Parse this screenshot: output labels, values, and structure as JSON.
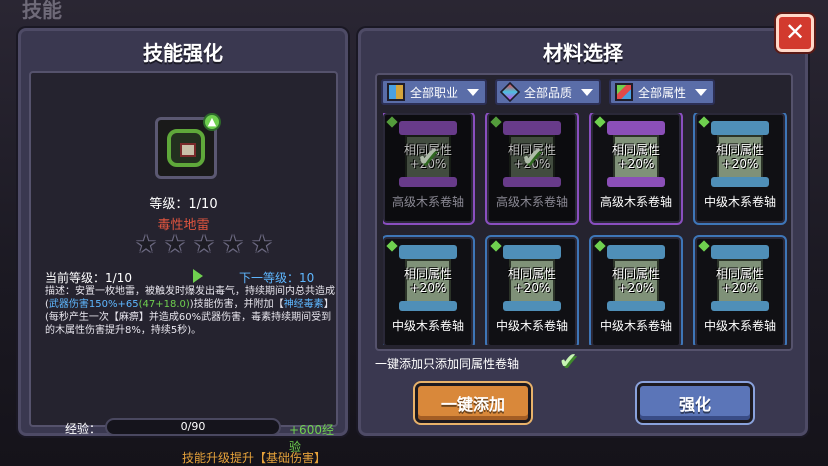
{
  "background": {
    "title": "技能"
  },
  "left_panel": {
    "title": "技能强化",
    "level_text": "等级：1/10",
    "skill_name": "毒性地雷",
    "stars": [
      0,
      0,
      0,
      0,
      0
    ],
    "current_level": "当前等级：1/10",
    "next_level": "下一等级：10",
    "description_1": "描述：安置一枚地雷，被触发时爆发出毒气，持续期间内总共造成(",
    "description_hl": "武器伤害150%+65",
    "description_hl2": "(47+18.0)",
    "description_2": ")技能伤害，并附加【",
    "description_hl3": "神经毒素",
    "description_3": "】(每秒产生一次【麻痹】并造成60%武器伤害，毒素持续期间受到的木属性伤害提升8%，持续5秒)。",
    "exp_label": "经验：",
    "exp_value": "0/90",
    "exp_fraction": 0,
    "exp_gain": "+600经验",
    "upgrade_hint": "技能升级提升【基础伤害】"
  },
  "right_panel": {
    "title": "材料选择",
    "filters": [
      {
        "label": "全部职业",
        "icon": "class-icon"
      },
      {
        "label": "全部品质",
        "icon": "quality-icon"
      },
      {
        "label": "全部属性",
        "icon": "attribute-icon"
      }
    ],
    "cards": [
      {
        "same": "相同属性",
        "bonus": "+20%",
        "label": "高级木系卷轴",
        "checked": true,
        "tier": "purple"
      },
      {
        "same": "相同属性",
        "bonus": "+20%",
        "label": "高级木系卷轴",
        "checked": true,
        "tier": "purple"
      },
      {
        "same": "相同属性",
        "bonus": "+20%",
        "label": "高级木系卷轴",
        "checked": false,
        "tier": "purple"
      },
      {
        "same": "相同属性",
        "bonus": "+20%",
        "label": "中级木系卷轴",
        "checked": false,
        "tier": "blue"
      },
      {
        "same": "相同属性",
        "bonus": "+20%",
        "label": "中级木系卷轴",
        "checked": false,
        "tier": "blue"
      },
      {
        "same": "相同属性",
        "bonus": "+20%",
        "label": "中级木系卷轴",
        "checked": false,
        "tier": "blue"
      },
      {
        "same": "相同属性",
        "bonus": "+20%",
        "label": "中级木系卷轴",
        "checked": false,
        "tier": "blue"
      },
      {
        "same": "相同属性",
        "bonus": "+20%",
        "label": "中级木系卷轴",
        "checked": false,
        "tier": "blue"
      }
    ],
    "auto_add_label": "一键添加只添加同属性卷轴",
    "auto_add_checked": true,
    "add_button": "一键添加",
    "strengthen_button": "强化"
  },
  "close_button": "✕",
  "colors": {
    "orange": "#d9883a",
    "blue": "#5b75b8",
    "green": "#6fd04f",
    "red": "#d23a2e"
  }
}
